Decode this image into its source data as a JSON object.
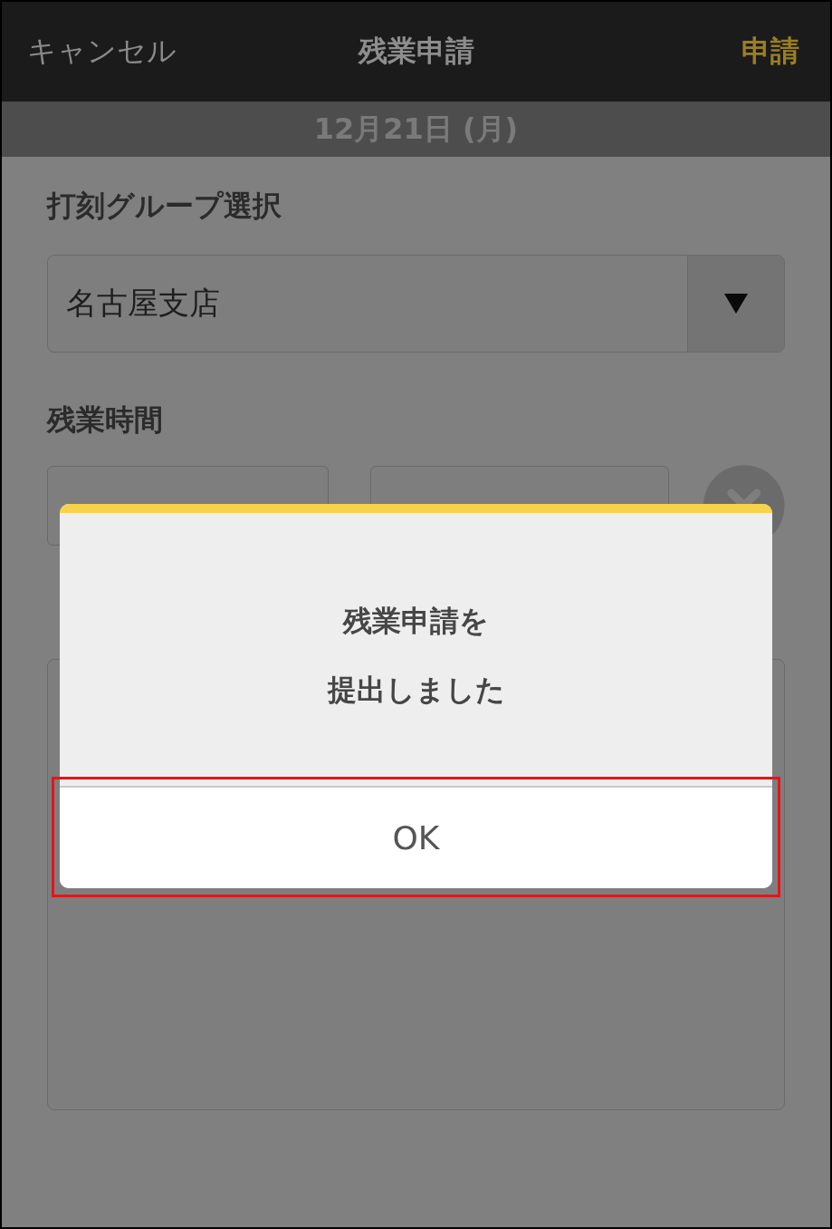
{
  "header": {
    "cancel": "キャンセル",
    "title": "残業申請",
    "submit": "申請"
  },
  "date": "12月21日 (月)",
  "group": {
    "label": "打刻グループ選択",
    "value": "名古屋支店"
  },
  "time": {
    "label": "残業時間"
  },
  "dialog": {
    "lines": [
      "残業申請を",
      "提出しました"
    ],
    "button": "OK",
    "highlighted": true
  }
}
